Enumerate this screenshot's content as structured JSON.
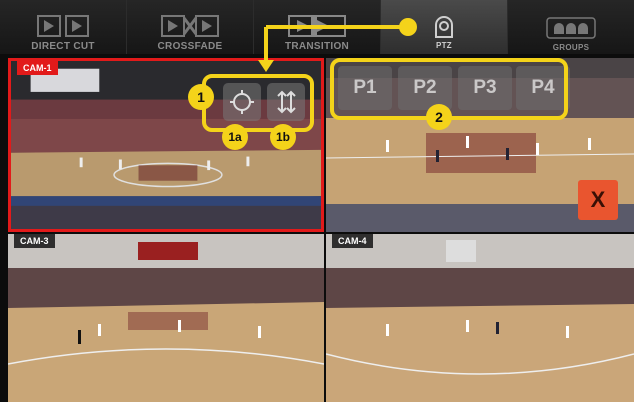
{
  "modes": [
    {
      "label": "DIRECT CUT",
      "icon": "direct-cut-icon"
    },
    {
      "label": "CROSSFADE",
      "icon": "crossfade-icon"
    },
    {
      "label": "TRANSITION",
      "icon": "transition-icon"
    },
    {
      "label": "PTZ",
      "icon": "ptz-icon"
    },
    {
      "label": "GROUPS",
      "icon": "groups-icon"
    }
  ],
  "cameras": [
    {
      "tag": "CAM-1",
      "selected": true
    },
    {
      "tag": "",
      "selected": false
    },
    {
      "tag": "CAM-3",
      "selected": false
    },
    {
      "tag": "CAM-4",
      "selected": false
    }
  ],
  "presets": [
    "P1",
    "P2",
    "P3",
    "P4"
  ],
  "close_label": "X",
  "callouts": {
    "c1": "1",
    "c1a": "1a",
    "c1b": "1b",
    "c2": "2"
  },
  "colors": {
    "accent_yellow": "#f4d31a",
    "selected_red": "#e21a1a",
    "close_orange": "#e9552f"
  }
}
